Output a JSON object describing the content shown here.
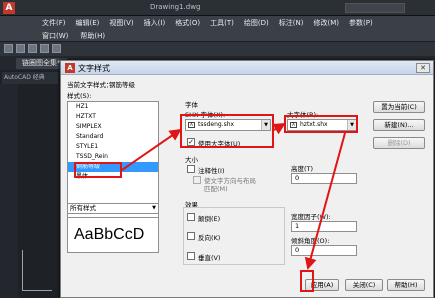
{
  "app": {
    "title": "Drawing1.dwg",
    "menu_row1": [
      "文件(F)",
      "编辑(E)",
      "视图(V)",
      "插入(I)",
      "格式(O)",
      "工具(T)",
      "绘图(D)",
      "标注(N)",
      "修改(M)",
      "参数(P)"
    ],
    "menu_row2": [
      "窗口(W)",
      "帮助(H)"
    ],
    "doc_tab": "链圈图全集*",
    "ws_label": "AutoCAD 经典"
  },
  "dialog": {
    "title": "文字样式",
    "close_glyph": "✕",
    "current_style_label": "当前文字样式：",
    "current_style_value": "钢筋等级",
    "styles_label": "样式(S):",
    "styles": [
      "HZ1",
      "HZTXT",
      "SIMPLEX",
      "Standard",
      "STYLE1",
      "TSSD_Rein",
      "钢筋等级",
      "黑体"
    ],
    "selected_style_index": 6,
    "filter_value": "所有样式",
    "preview_text": "AaBbCcD",
    "font_group_label": "字体",
    "shx_font_label": "SHX 字体(X):",
    "shx_font_value": "tssdeng.shx",
    "big_font_label": "大字体(B):",
    "big_font_value": "hztxt.shx",
    "use_big_font_label": "使用大字体(U)",
    "use_big_font_checked": true,
    "size_group_label": "大小",
    "annotative_label": "注释性(I)",
    "match_orientation_label": "使文字方向与布局",
    "match_orientation_label2": "匹配(M)",
    "height_label": "高度(T)",
    "height_value": "0",
    "effects_group_label": "效果",
    "upside_down_label": "颠倒(E)",
    "backwards_label": "反向(K)",
    "vertical_label": "垂直(V)",
    "width_factor_label": "宽度因子(W):",
    "width_factor_value": "1",
    "oblique_label": "倾斜角度(O):",
    "oblique_value": "0",
    "set_current_button": "置为当前(C)",
    "new_button": "新建(N)...",
    "delete_button": "删除(D)",
    "apply_button": "应用(A)",
    "close_button": "关闭(C)",
    "help_button": "帮助(H)"
  },
  "colors": {
    "highlight": "#e01515"
  }
}
